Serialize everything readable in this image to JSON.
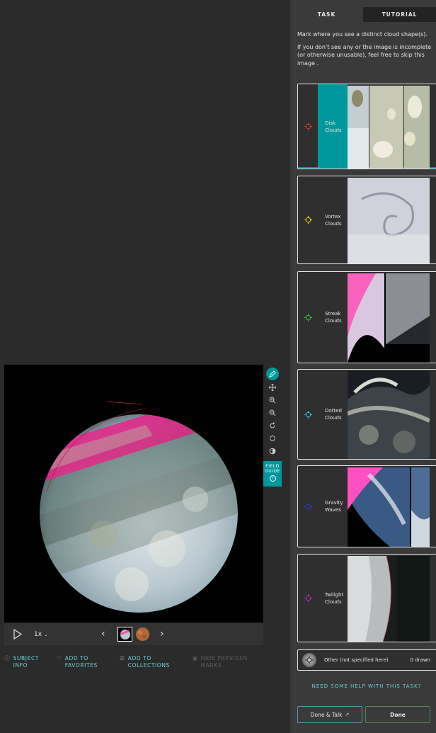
{
  "tabs": [
    {
      "label": "TASK",
      "active": true
    },
    {
      "label": "TUTORIAL",
      "active": false
    }
  ],
  "instructions": {
    "line1": "Mark where you see a distinct cloud shape(s).",
    "line2": "If you don't see any or the image is incomplete (or otherwise unusable), feel free to skip this image ."
  },
  "choices": [
    {
      "label_line1": "Disk",
      "label_line2": "Clouds",
      "icon": "crosshair-icon",
      "color": "#e0342b",
      "selected": true
    },
    {
      "label_line1": "Vortex",
      "label_line2": "Clouds",
      "icon": "crosshair-icon",
      "color": "#e8d21f",
      "selected": false
    },
    {
      "label_line1": "Streak",
      "label_line2": "Clouds",
      "icon": "crosshair-icon",
      "color": "#36c23a",
      "selected": false
    },
    {
      "label_line1": "Dotted",
      "label_line2": "Clouds",
      "icon": "crosshair-icon",
      "color": "#2bc0d4",
      "selected": false
    },
    {
      "label_line1": "Gravity",
      "label_line2": "Waves",
      "icon": "crosshair-icon",
      "color": "#2a35d4",
      "selected": false
    },
    {
      "label_line1": "Twilight",
      "label_line2": "Clouds",
      "icon": "crosshair-icon",
      "color": "#c42bc0",
      "selected": false
    }
  ],
  "other": {
    "label": "Other (not specified here)",
    "count": "0 drawn"
  },
  "help": "NEED SOME HELP WITH THIS TASK?",
  "buttons": {
    "done_talk": "Done & Talk",
    "done": "Done"
  },
  "field_guide": {
    "line1": "FIELD",
    "line2": "GUIDE",
    "q": "?"
  },
  "controls": {
    "rate": "1x",
    "prev": "‹",
    "next": "›"
  },
  "meta": {
    "subject_info_1": "SUBJECT",
    "subject_info_2": "INFO",
    "favorites_1": "ADD TO",
    "favorites_2": "FAVORITES",
    "collections_1": "ADD TO",
    "collections_2": "COLLECTIONS",
    "hide_marks_1": "HIDE PREVIOUS",
    "hide_marks_2": "MARKS"
  },
  "colors": {
    "accent": "#00979d",
    "link": "#6fd0d4",
    "done_border": "#4d8a55"
  }
}
